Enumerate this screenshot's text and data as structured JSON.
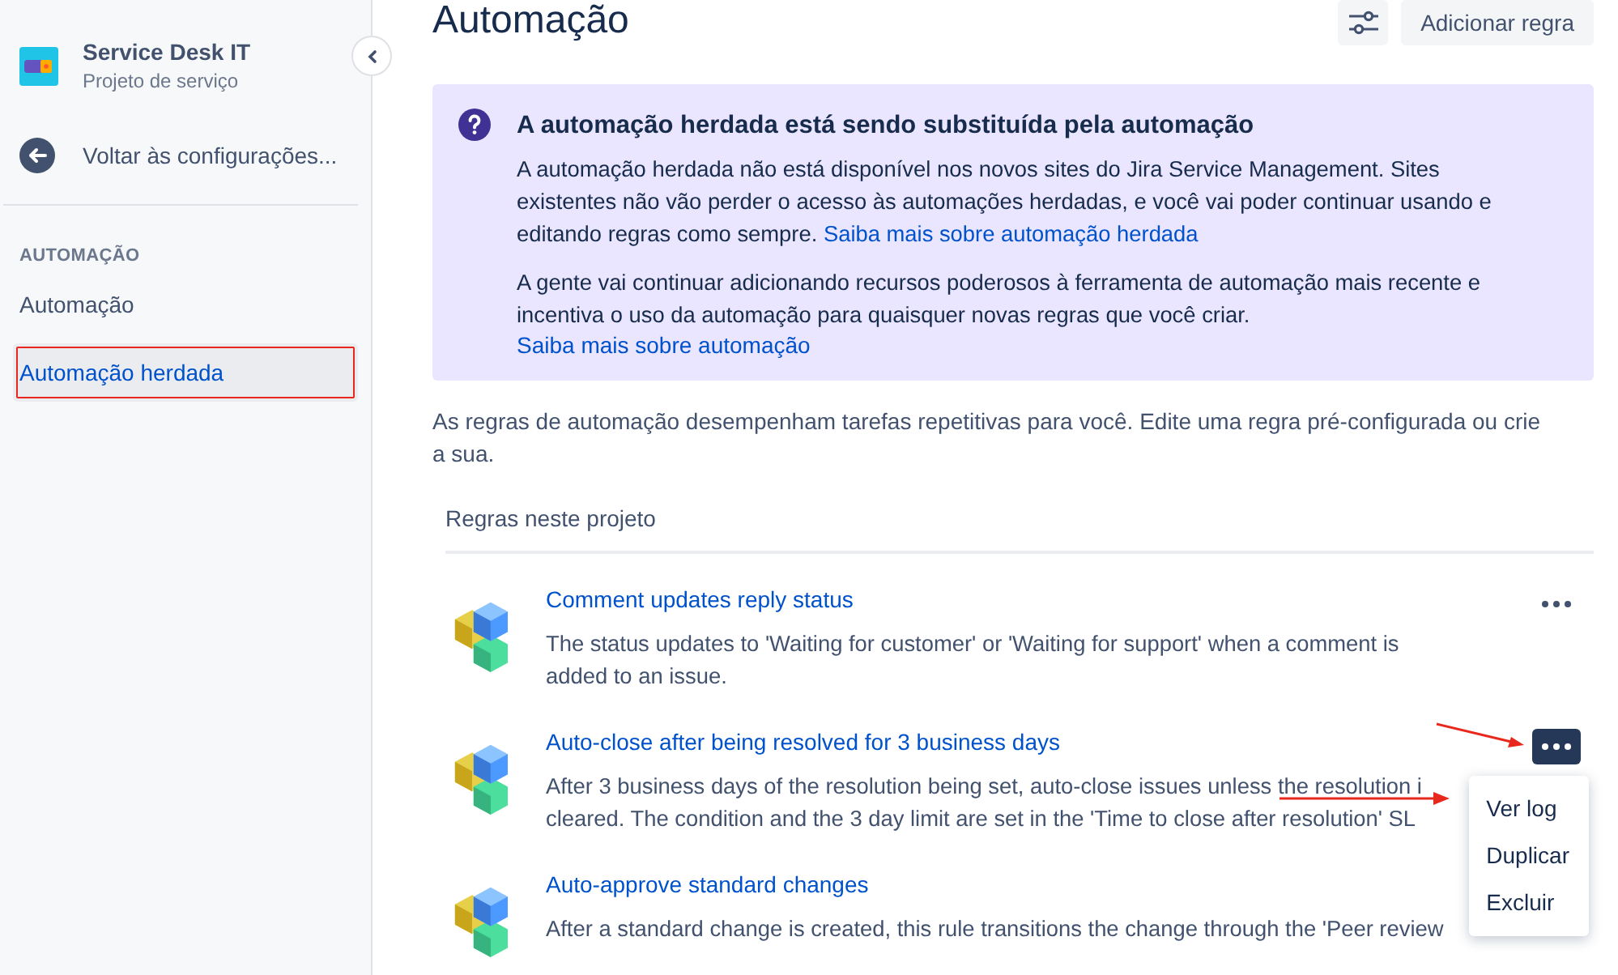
{
  "sidebar": {
    "project": {
      "name": "Service Desk IT",
      "type": "Projeto de serviço"
    },
    "back_link": "Voltar às configurações...",
    "section_heading": "AUTOMAÇÃO",
    "items": [
      {
        "label": "Automação",
        "selected": false,
        "highlighted": false
      },
      {
        "label": "Automação herdada",
        "selected": true,
        "highlighted": true
      }
    ]
  },
  "header": {
    "title": "Automação",
    "add_button": "Adicionar regra"
  },
  "banner": {
    "title": "A automação herdada está sendo substituída pela automação",
    "paragraph_1": "A automação herdada não está disponível nos novos sites do Jira Service Management. Sites existentes não vão perder o acesso às automações herdadas, e você vai poder continuar usando e editando regras como sempre.",
    "link_1": "Saiba mais sobre automação herdada",
    "paragraph_2": "A gente vai continuar adicionando recursos poderosos à ferramenta de automação mais recente e incentiva o uso da automação para quaisquer novas regras que você criar.",
    "link_2": "Saiba mais sobre automação"
  },
  "intro": "As regras de automação desempenham tarefas repetitivas para você. Edite uma regra pré-configurada ou crie a sua.",
  "rules_heading": "Regras neste projeto",
  "rules": [
    {
      "name": "Comment updates reply status",
      "description_lines": [
        "The status updates to 'Waiting for customer' or 'Waiting for support' when a comment is",
        "added to an issue."
      ],
      "menu_active": false
    },
    {
      "name": "Auto-close after being resolved for 3 business days",
      "description_lines": [
        "After 3 business days of the resolution being set, auto-close issues unless the resolution i",
        "cleared. The condition and the 3 day limit are set in the 'Time to close after resolution' SL"
      ],
      "menu_active": true,
      "arrow": true,
      "menu": [
        {
          "label": "Ver log",
          "arrow": true
        },
        {
          "label": "Duplicar"
        },
        {
          "label": "Excluir"
        }
      ]
    },
    {
      "name": "Auto-approve standard changes",
      "description_lines": [
        "After a standard change is created, this rule transitions the change through the 'Peer review"
      ]
    }
  ]
}
